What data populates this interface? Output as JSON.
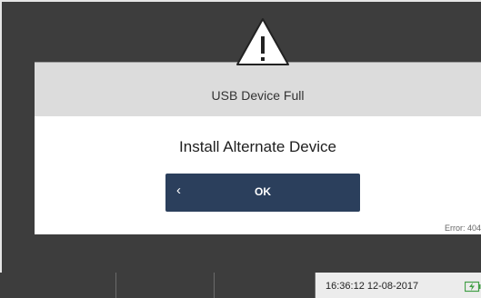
{
  "dialog": {
    "title": "USB Device Full",
    "message": "Install Alternate Device",
    "ok_button": {
      "chevron": "‹",
      "label": "OK"
    },
    "error_code": "Error: 404"
  },
  "statusbar": {
    "time": "16:36:12",
    "date": "12-08-2017",
    "datetime": "16:36:12  12-08-2017"
  },
  "icons": {
    "warning": "warning-triangle-icon",
    "battery": "battery-charging-icon"
  },
  "colors": {
    "background": "#3d3d3d",
    "header": "#dcdcdc",
    "button": "#2b3f5c",
    "battery": "#43a047"
  }
}
